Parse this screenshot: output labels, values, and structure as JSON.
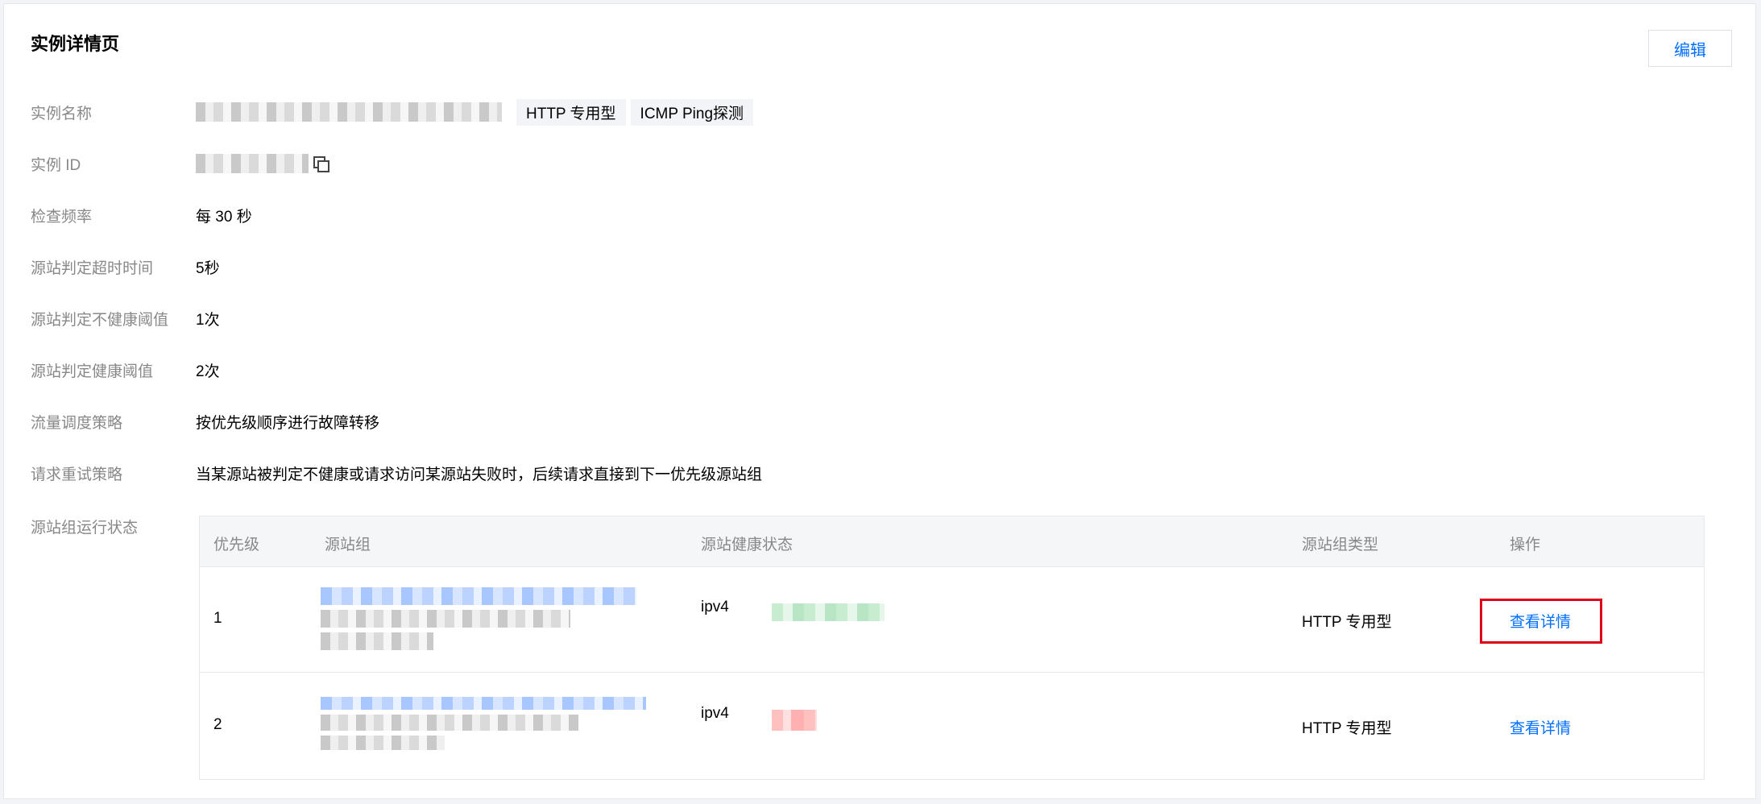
{
  "page": {
    "title": "实例详情页",
    "edit_label": "编辑"
  },
  "fields": [
    {
      "label": "实例名称",
      "tags": [
        "HTTP 专用型",
        "ICMP Ping探测"
      ]
    },
    {
      "label": "实例 ID"
    },
    {
      "label": "检查频率",
      "value": "每 30 秒"
    },
    {
      "label": "源站判定超时时间",
      "value": "5秒"
    },
    {
      "label": "源站判定不健康阈值",
      "value": "1次"
    },
    {
      "label": "源站判定健康阈值",
      "value": "2次"
    },
    {
      "label": "流量调度策略",
      "value": "按优先级顺序进行故障转移"
    },
    {
      "label": "请求重试策略",
      "value": "当某源站被判定不健康或请求访问某源站失败时，后续请求直接到下一优先级源站组"
    }
  ],
  "origin_status": {
    "label": "源站组运行状态",
    "columns": [
      "优先级",
      "源站组",
      "源站健康状态",
      "源站组类型",
      "操作"
    ],
    "rows": [
      {
        "priority": "1",
        "health_protocol": "ipv4",
        "type": "HTTP 专用型",
        "action": "查看详情"
      },
      {
        "priority": "2",
        "health_protocol": "ipv4",
        "type": "HTTP 专用型",
        "action": "查看详情"
      }
    ]
  },
  "colors": {
    "link": "#006eff",
    "highlight": "#e0001b"
  }
}
